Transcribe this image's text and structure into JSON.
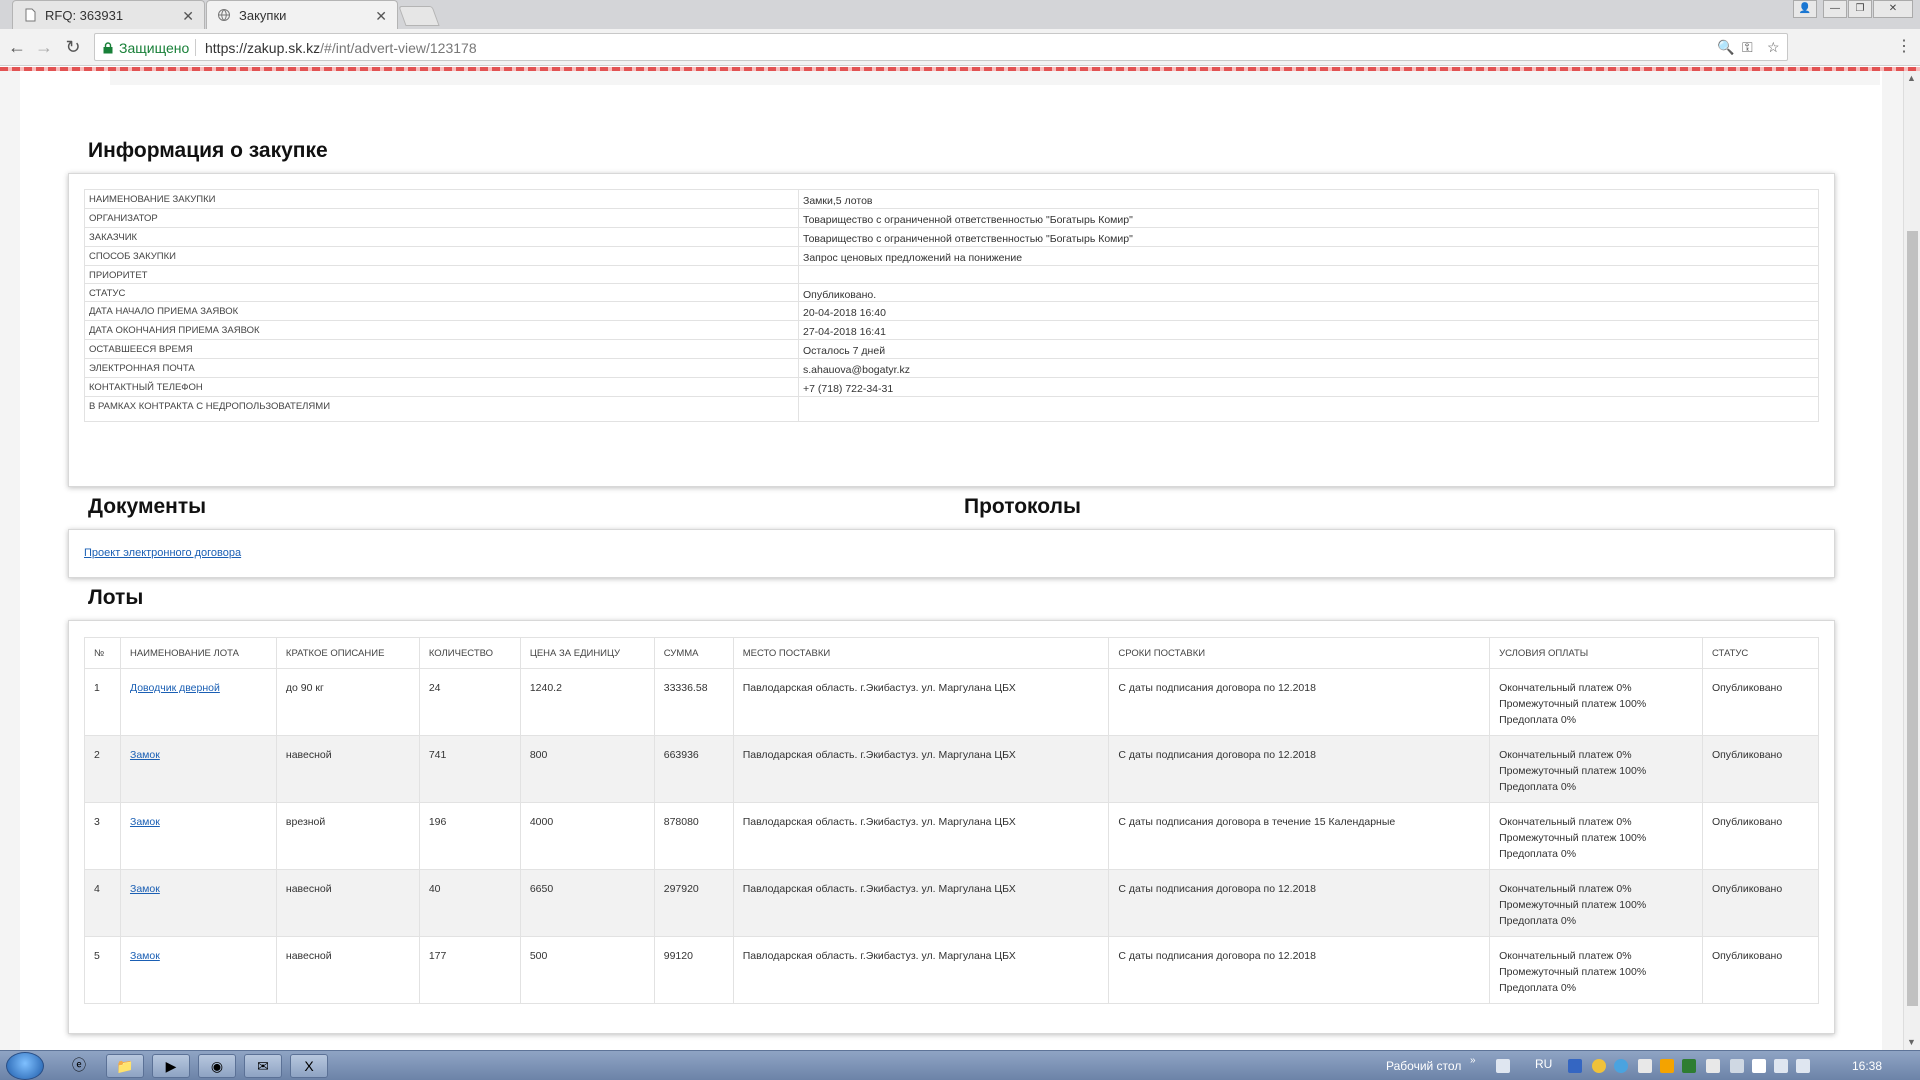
{
  "browser": {
    "tabs": [
      {
        "title": "RFQ: 363931",
        "active": false
      },
      {
        "title": "Закупки",
        "active": true
      }
    ],
    "secure_label": "Защищено",
    "url_host": "https://zakup.sk.kz",
    "url_path": "/#/int/advert-view/123178"
  },
  "info": {
    "heading": "Информация о закупке",
    "rows": [
      {
        "label": "Наименование закупки",
        "value": "Замки,5 лотов"
      },
      {
        "label": "Организатор",
        "value": "Товарищество с ограниченной ответственностью \"Богатырь Комир\""
      },
      {
        "label": "Заказчик",
        "value": "Товарищество с ограниченной ответственностью \"Богатырь Комир\""
      },
      {
        "label": "Способ закупки",
        "value": "Запрос ценовых предложений на понижение"
      },
      {
        "label": "Приоритет",
        "value": ""
      },
      {
        "label": "Статус",
        "value": "Опубликовано."
      },
      {
        "label": "Дата начало приема заявок",
        "value": "20-04-2018 16:40"
      },
      {
        "label": "Дата окончания приема заявок",
        "value": "27-04-2018 16:41"
      },
      {
        "label": "Оставшееся время",
        "value": "Осталось 7 дней"
      },
      {
        "label": "Электронная почта",
        "value": "s.ahauova@bogatyr.kz"
      },
      {
        "label": "Контактный телефон",
        "value": "+7 (718) 722-34-31"
      },
      {
        "label": "В рамках контракта с недропользователями",
        "value": ""
      }
    ]
  },
  "documents": {
    "heading": "Документы",
    "protocols_heading": "Протоколы",
    "link": "Проект электронного договора"
  },
  "lots": {
    "heading": "Лоты",
    "columns": [
      "№",
      "Наименование лота",
      "Краткое описание",
      "Количество",
      "Цена за единицу",
      "Сумма",
      "Место поставки",
      "Сроки поставки",
      "Условия оплаты",
      "Статус"
    ],
    "rows": [
      {
        "n": "1",
        "name": "Доводчик дверной",
        "desc": "до 90 кг",
        "qty": "24",
        "price": "1240.2",
        "sum": "33336.58",
        "place": "Павлодарская область. г.Экибастуз. ул. Маргулана ЦБХ",
        "term": "С даты подписания договора по 12.2018",
        "pay1": "Окончательный платеж 0%",
        "pay2": "Промежуточный платеж 100%",
        "pay3": "Предоплата 0%",
        "status": "Опубликовано"
      },
      {
        "n": "2",
        "name": "Замок",
        "desc": "навесной",
        "qty": "741",
        "price": "800",
        "sum": "663936",
        "place": "Павлодарская область. г.Экибастуз. ул. Маргулана ЦБХ",
        "term": "С даты подписания договора по 12.2018",
        "pay1": "Окончательный платеж 0%",
        "pay2": "Промежуточный платеж 100%",
        "pay3": "Предоплата 0%",
        "status": "Опубликовано"
      },
      {
        "n": "3",
        "name": "Замок",
        "desc": "врезной",
        "qty": "196",
        "price": "4000",
        "sum": "878080",
        "place": "Павлодарская область. г.Экибастуз. ул. Маргулана ЦБХ",
        "term": "С даты подписания договора в течение 15 Календарные",
        "pay1": "Окончательный платеж 0%",
        "pay2": "Промежуточный платеж 100%",
        "pay3": "Предоплата 0%",
        "status": "Опубликовано"
      },
      {
        "n": "4",
        "name": "Замок",
        "desc": "навесной",
        "qty": "40",
        "price": "6650",
        "sum": "297920",
        "place": "Павлодарская область. г.Экибастуз. ул. Маргулана ЦБХ",
        "term": "С даты подписания договора по 12.2018",
        "pay1": "Окончательный платеж 0%",
        "pay2": "Промежуточный платеж 100%",
        "pay3": "Предоплата 0%",
        "status": "Опубликовано"
      },
      {
        "n": "5",
        "name": "Замок",
        "desc": "навесной",
        "qty": "177",
        "price": "500",
        "sum": "99120",
        "place": "Павлодарская область. г.Экибастуз. ул. Маргулана ЦБХ",
        "term": "С даты подписания договора по 12.2018",
        "pay1": "Окончательный платеж 0%",
        "pay2": "Промежуточный платеж 100%",
        "pay3": "Предоплата 0%",
        "status": "Опубликовано"
      }
    ]
  },
  "taskbar": {
    "desktop_label": "Рабочий стол",
    "lang": "RU",
    "time": "16:38"
  },
  "icons": {
    "browser": [
      "page-icon",
      "globe-icon",
      "back-arrow-icon",
      "forward-arrow-icon",
      "reload-icon",
      "lock-icon",
      "zoom-icon",
      "key-icon",
      "star-icon",
      "menu-dots-icon"
    ],
    "taskbar": [
      "start-orb-icon",
      "ie-icon",
      "explorer-folder-icon",
      "media-player-icon",
      "chrome-icon",
      "outlook-icon",
      "excel-icon"
    ]
  },
  "colors": {
    "link": "#1a5fb4",
    "secure": "#188038",
    "alt_row": "#f2f2f2"
  }
}
